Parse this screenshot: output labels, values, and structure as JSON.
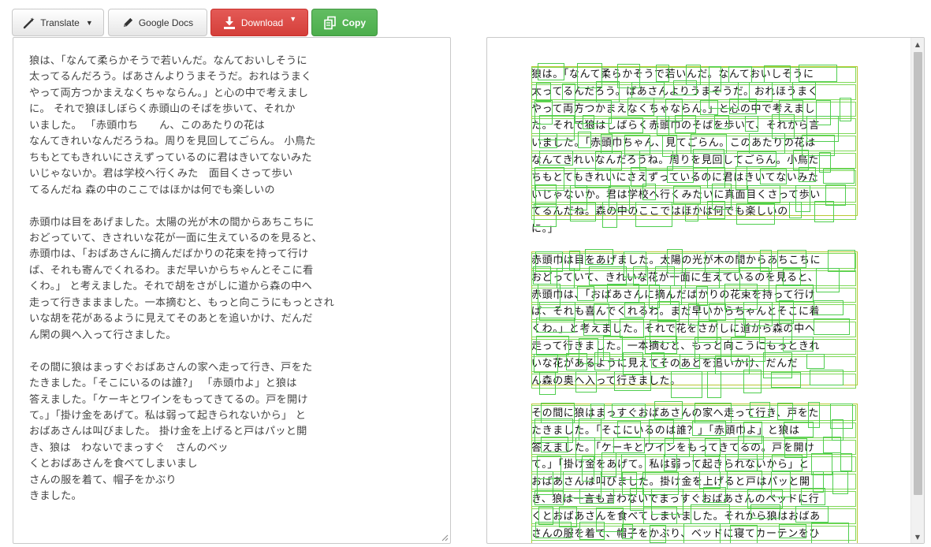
{
  "toolbar": {
    "translate_label": "Translate",
    "google_docs_label": "Google Docs",
    "download_label": "Download",
    "copy_label": "Copy"
  },
  "icons": {
    "translate": "magic-wand-icon",
    "google_docs": "pencil-icon",
    "download": "download-icon",
    "copy": "copy-icon"
  },
  "colors": {
    "download_bg": "#d9534f",
    "copy_bg": "#5cb85c",
    "ocr_box": "#7ed957",
    "ocr_line": "#b9c832"
  },
  "left_text": {
    "content": "狼は、「なんて柔らかそうで若いんだ。なんておいしそうに\n太ってるんだろう。ばあさんよりうまそうだ。おれはうまく\nやって両方つかまえなくちゃならん。」と心の中で考えまし\nに。 それで狼ほしぼらく赤頭山のそばを歩いて、それか\nいました。 「赤頭巾ち　　ん、このあたりの花は\nなんてきれいなんだろうね。周りを見回してごらん。 小鳥た\nちもとてもきれいにさえずっているのに君はきいてないみた\nいじゃないか。君は学校へ行くみた　面目くさって歩い\nてるんだね 森の中のここではほかは何でも楽しいの\n\n赤頭巾は目をあげました。太陽の光が木の間からあちこちに\nおどっていて、きされいな花が一面に生えているのを見ると、\n赤頭巾は、「おばあさんに摘んだばかりの花束を持って行け\nば、それも寄んでくれるわ。まだ早いからちゃんとそこに看\nくわ。」 と考えました。それで胡をさがしに道から森の中へ\n走って行きままました。一本摘むと、もっと向こうにもっとされ\nいな胡を花があるように見えてそのあとを追いかけ、だんだ\nん閑の興へ入って行さました。\n\nその間に狼はまっすぐおばあさんの家へ走って行き、戸をた\nたきました。「そこにいるのは誰?」 「赤頭巾よ」と狼は\n答えました。「ケーキとワインをもってきてるの。戸を開け\nて。」「掛け金をあげて。私は弱って起きられないから」 と\nおばあさんは叫びました。 掛け金を上げると戸はパッと開\nき、狼は　わないでまっすぐ　さんのベッ\nくとおばあさんを食べてしまいまし\nさんの服を着て、帽子をかぶり\nきました。"
  },
  "ocr_image": {
    "para1": "狼は。「なんて柔らかそうで若いんだ。なんておいしそうに\n太ってるんだろう。ばあさんよりうまそうだ。おれほうまく\nやって両方つかまえなくちゃならん。」と心の中で考えまし\nた。それで狼はしばらく赤頭巾のそばを歩いて、それから言\nいました。「赤頭巾ちゃん、見てごらん。このあたりの花は\nなんてきれいなんだろうね。周りを見回してごらん。小鳥た\nちもとてもきれいにさえずっているのに君はきいてないみた\nいじゃないか。君は学校へ行くみたいに真面目くさって歩い\nてるんだね。森の中のここではほかは何でも楽しいの\nに。」",
    "para2": "赤頭巾は目をあげました。太陽の光が木の間からあちこちに\nおどっていて、きれいな花が一面に生えているのを見ると、\n赤頭巾は、「おばあさんに摘んだばかりの花束を持って行け\nば、それも喜んでくれるわ。まだ早いからちゃんとそこに着\nくわ。」と考えました。それで花をさがしに道から森の中へ\n走って行きました。一本摘むと、もっと向こうにもっときれ\nいな花があるように見えてそのあとを追いかけ、だんだ\nん森の奥へ入って行きました。",
    "para3": "その間に狼はまっすぐおばあさんの家へ走って行き、戸をた\nたきました。「そこにいるのは誰？」「赤頭巾よ」と狼は\n答えました。「ケーキとワインをもってきてるの。戸を開け\nて。」「掛け金をあげて。私は弱って起きられないから」と\nおばあさんは叫びました。掛け金を上げると戸はパッと開\nき、狼は一言も言わないでまっすぐおばあさんのベッドに行\nくとおばあさんを食べてしまいました。それから狼はおばあ\nさんの服を着て、帽子をかぶり、ベッドに寝てカーテンをひ"
  }
}
